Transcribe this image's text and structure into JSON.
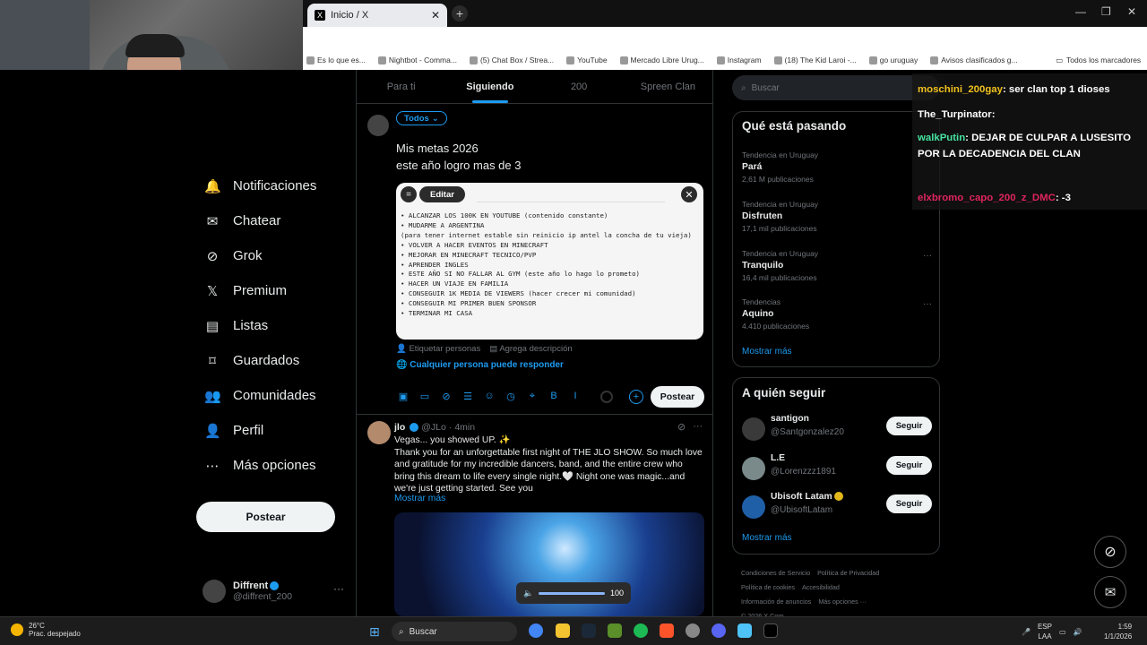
{
  "browser": {
    "tab_title": "Inicio / X",
    "bookmarks": [
      "Es lo que es...",
      "Nightbot - Comma...",
      "(5) Chat Box / Strea...",
      "YouTube",
      "Mercado Libre Urug...",
      "Instagram",
      "(18) The Kid Laroi -...",
      "go uruguay",
      "Avisos clasificados g..."
    ],
    "all_bookmarks": "Todos los marcadores"
  },
  "nav": {
    "items": [
      {
        "label": "Notificaciones",
        "icon": "bell-icon"
      },
      {
        "label": "Chatear",
        "icon": "mail-icon"
      },
      {
        "label": "Grok",
        "icon": "grok-icon"
      },
      {
        "label": "Premium",
        "icon": "x-icon"
      },
      {
        "label": "Listas",
        "icon": "list-icon"
      },
      {
        "label": "Guardados",
        "icon": "bookmark-icon"
      },
      {
        "label": "Comunidades",
        "icon": "communities-icon"
      },
      {
        "label": "Perfil",
        "icon": "person-icon"
      },
      {
        "label": "Más opciones",
        "icon": "more-icon"
      }
    ],
    "post_button": "Postear",
    "profile": {
      "name": "Diffrent",
      "handle": "@diffrent_200"
    }
  },
  "timeline": {
    "tabs": [
      "Para ti",
      "Siguiendo",
      "200",
      "Spreen Clan"
    ],
    "active_tab": "Siguiendo"
  },
  "composer": {
    "audience": "Todos",
    "text_line1": "Mis metas 2026",
    "text_line2": "este año logro mas de 3",
    "edit_label": "Editar",
    "image_lines": [
      "• ALCANZAR LOS 100K EN YOUTUBE (contenido constante)",
      "• MUDARME A ARGENTINA",
      "(para tener internet estable sin reinicio ip antel la concha de tu vieja)",
      "• VOLVER A HACER EVENTOS EN MINECRAFT",
      "• MEJORAR EN MINECRAFT TECNICO/PVP",
      "• APRENDER INGLES",
      "• ESTE AÑO SI NO FALLAR AL GYM (este año lo hago lo prometo)",
      "• HACER UN VIAJE EN FAMILIA",
      "• CONSEGUIR 1K MEDIA DE VIEWERS (hacer crecer mi comunidad)",
      "• CONSEGUIR MI PRIMER BUEN SPONSOR",
      "• TERMINAR MI CASA"
    ],
    "tag_people": "Etiquetar personas",
    "add_description": "Agrega descripción",
    "reply_setting": "Cualquier persona puede responder",
    "post_button": "Postear"
  },
  "tweet": {
    "name": "jlo",
    "handle": "@JLo",
    "time": "4min",
    "line1": "Vegas... you showed UP. ✨",
    "body": "Thank you for an unforgettable first night of THE JLO SHOW. So much love and gratitude for my incredible dancers, band, and the entire crew who bring this dream to life every single night.🤍 Night one was magic...and we're just getting started. See you",
    "show_more": "Mostrar más",
    "volume": "100"
  },
  "right": {
    "search_placeholder": "Buscar",
    "trends_title": "Qué está pasando",
    "trends": [
      {
        "context": "Tendencia en Uruguay",
        "title": "Pará",
        "count": "2,61 M publicaciones"
      },
      {
        "context": "Tendencia en Uruguay",
        "title": "Disfruten",
        "count": "17,1 mil publicaciones"
      },
      {
        "context": "Tendencia en Uruguay",
        "title": "Tranquilo",
        "count": "16,4 mil publicaciones"
      },
      {
        "context": "Tendencias",
        "title": "Aquino",
        "count": "4.410 publicaciones"
      }
    ],
    "trends_more": "Mostrar más",
    "follow_title": "A quién seguir",
    "follow": [
      {
        "name": "santigon",
        "handle": "@Santgonzalez20",
        "button": "Seguir"
      },
      {
        "name": "L.E",
        "handle": "@Lorenzzz1891",
        "button": "Seguir"
      },
      {
        "name": "Ubisoft Latam",
        "handle": "@UbisoftLatam",
        "button": "Seguir"
      }
    ],
    "follow_more": "Mostrar más",
    "footer": [
      "Condiciones de Servicio",
      "Política de Privacidad",
      "Política de cookies",
      "Accesibilidad",
      "Información de anuncios",
      "Más opciones ···",
      "© 2026 X Corp."
    ]
  },
  "chat": [
    {
      "user": "moschini_200gay",
      "msg": ": ser clan top 1 dioses"
    },
    {
      "user": "The_Turpinator",
      "msg": ":"
    },
    {
      "user": "walkPutin",
      "msg": ": DEJAR DE CULPAR A LUSESITO POR LA DECADENCIA DEL CLAN"
    },
    {
      "user": "elxbromo_capo_200_z_DMC",
      "msg": ": -3"
    }
  ],
  "taskbar": {
    "weather_temp": "26°C",
    "weather_desc": "Prac. despejado",
    "search": "Buscar",
    "lang1": "ESP",
    "lang2": "LAA",
    "time": "1:59",
    "date": "1/1/2026"
  }
}
